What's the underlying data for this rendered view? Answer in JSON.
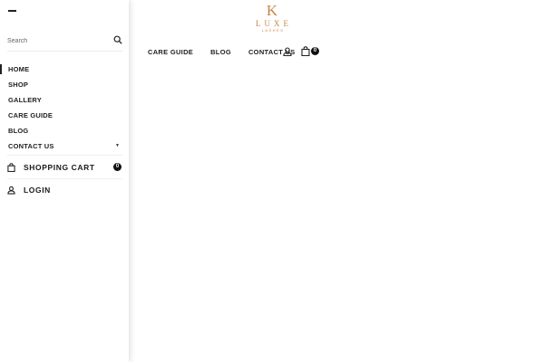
{
  "logo": {
    "monogram": "K",
    "word": "LUXE",
    "tagline": "LASHES",
    "color": "#c8874a"
  },
  "header": {
    "nav": [
      "CARE GUIDE",
      "BLOG",
      "CONTACT US"
    ],
    "cart_count": "0"
  },
  "drawer": {
    "search_placeholder": "Search",
    "menu": [
      "HOME",
      "SHOP",
      "GALLERY",
      "CARE GUIDE",
      "BLOG",
      "CONTACT US"
    ],
    "active_item": "HOME",
    "cart_label": "SHOPPING CART",
    "cart_count": "0",
    "login_label": "LOGIN"
  },
  "icons": [
    "close-icon",
    "search-icon",
    "chevron-down-icon",
    "user-icon",
    "shopping-bag-icon"
  ]
}
